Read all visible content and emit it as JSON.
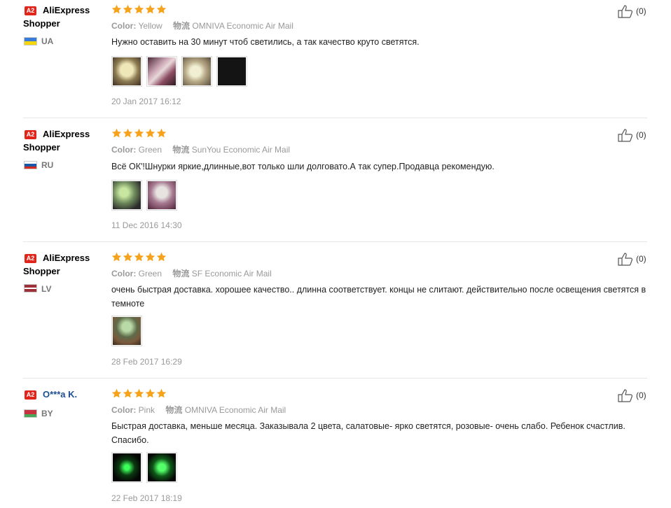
{
  "colors": {
    "badge": "#e1251b",
    "star": "#f7a21b",
    "masked_name": "#1d4f91"
  },
  "reviews": [
    {
      "badge": "A2",
      "name_line1": "AliExpress",
      "name_line2": "Shopper",
      "country": "UA",
      "flag": "ua",
      "rating": 5,
      "color_label": "Color:",
      "color_value": "Yellow",
      "ship_label": "物流",
      "ship_value": "OMNIVA Economic Air Mail",
      "text": "Нужно оставить на 30 минут чтоб светились, а так качество круто светятся.",
      "photos": [
        "photo-yellow-laces-1",
        "photo-yellow-laces-2",
        "photo-yellow-laces-3",
        "photo-dark-glow"
      ],
      "date": "20 Jan 2017 16:12",
      "likes": "(0)"
    },
    {
      "badge": "A2",
      "name_line1": "AliExpress",
      "name_line2": "Shopper",
      "country": "RU",
      "flag": "ru",
      "rating": 5,
      "color_label": "Color:",
      "color_value": "Green",
      "ship_label": "物流",
      "ship_value": "SunYou Economic Air Mail",
      "text": "Всё ОК'!Шнурки яркие,длинные,вот только шли долговато.А так супер.Продавца рекомендую.",
      "photos": [
        "photo-green-package",
        "photo-green-laces"
      ],
      "date": "11 Dec 2016 14:30",
      "likes": "(0)"
    },
    {
      "badge": "A2",
      "name_line1": "AliExpress",
      "name_line2": "Shopper",
      "country": "LV",
      "flag": "lv",
      "rating": 5,
      "color_label": "Color:",
      "color_value": "Green",
      "ship_label": "物流",
      "ship_value": "SF Economic Air Mail",
      "text": "очень быстрая доставка. хорошее качество.. длинна соответствует. концы не слитают. действительно после освещения светятся в темноте",
      "photos": [
        "photo-green-glow-hand"
      ],
      "date": "28 Feb 2017 16:29",
      "likes": "(0)"
    },
    {
      "badge": "A2",
      "name_line1": "O***a K.",
      "name_line2": "",
      "country": "BY",
      "flag": "by",
      "rating": 5,
      "color_label": "Color:",
      "color_value": "Pink",
      "ship_label": "物流",
      "ship_value": "OMNIVA Economic Air Mail",
      "text": "Быстрая доставка, меньше месяца. Заказывала 2 цвета, салатовые- ярко светятся, розовые- очень слабо. Ребенок счастлив. Спасибо.",
      "photos": [
        "photo-green-glow-dark-1",
        "photo-green-glow-dark-2"
      ],
      "date": "22 Feb 2017 18:19",
      "likes": "(0)"
    }
  ]
}
